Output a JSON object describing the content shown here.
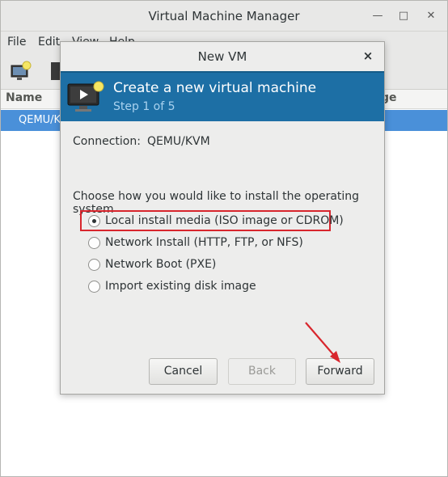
{
  "main": {
    "title": "Virtual Machine Manager",
    "menu": [
      "File",
      "Edit",
      "View",
      "Help"
    ],
    "header": {
      "name": "Name",
      "usage": "ge"
    },
    "selected_row": "QEMU/KV"
  },
  "dialog": {
    "title": "New VM",
    "close": "×",
    "banner": {
      "title": "Create a new virtual machine",
      "step": "Step 1 of 5"
    },
    "connection": {
      "label": "Connection:",
      "value": "QEMU/KVM"
    },
    "prompt": "Choose how you would like to install the operating system",
    "options": [
      {
        "label": "Local install media (ISO image or CDROM)",
        "checked": true
      },
      {
        "label": "Network Install (HTTP, FTP, or NFS)",
        "checked": false
      },
      {
        "label": "Network Boot (PXE)",
        "checked": false
      },
      {
        "label": "Import existing disk image",
        "checked": false
      }
    ],
    "buttons": {
      "cancel": "Cancel",
      "back": "Back",
      "forward": "Forward"
    }
  },
  "colors": {
    "banner": "#1d6fa5",
    "selection": "#4a90d9",
    "annotation": "#d8262d"
  }
}
